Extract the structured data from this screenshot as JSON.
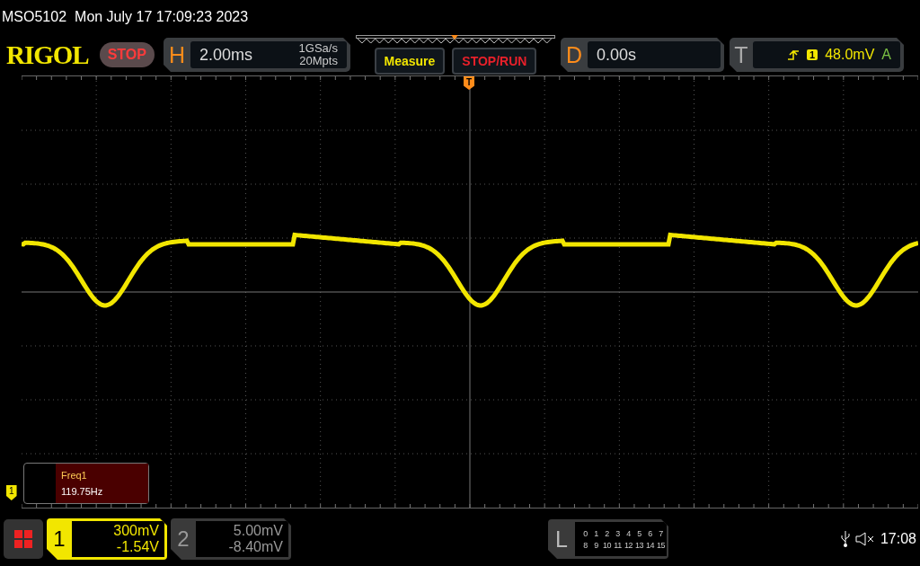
{
  "header": {
    "model": "MSO5102",
    "datetime": "Mon July 17 17:09:23 2023"
  },
  "toolbar": {
    "logo": "RIGOL",
    "run_state": "STOP",
    "horizontal": {
      "label": "H",
      "scale": "2.00ms",
      "sample_rate": "1GSa/s",
      "memory_depth": "20Mpts"
    },
    "buttons": [
      {
        "label": "Measure",
        "color": "#f2e600"
      },
      {
        "label": "STOP/RUN",
        "color": "#e8202a"
      }
    ],
    "delay": {
      "label": "D",
      "value": "0.00s"
    },
    "trigger": {
      "label": "T",
      "source": "1",
      "level": "48.0mV",
      "mode": "A"
    }
  },
  "screen": {
    "trigger_marker": "T",
    "channel_marker": "1",
    "measurement": {
      "name": "Freq1",
      "value": "119.75Hz"
    }
  },
  "channels": [
    {
      "number": "1",
      "scale": "300mV",
      "offset": "-1.54V",
      "selected": true
    },
    {
      "number": "2",
      "scale": "5.00mV",
      "offset": "-8.40mV",
      "selected": false
    }
  ],
  "logic": {
    "label": "L",
    "rows": [
      [
        "0",
        "1",
        "2",
        "3",
        "4",
        "5",
        "6",
        "7"
      ],
      [
        "8",
        "9",
        "10",
        "11",
        "12",
        "13",
        "14",
        "15"
      ]
    ]
  },
  "status": {
    "clock": "17:08"
  }
}
